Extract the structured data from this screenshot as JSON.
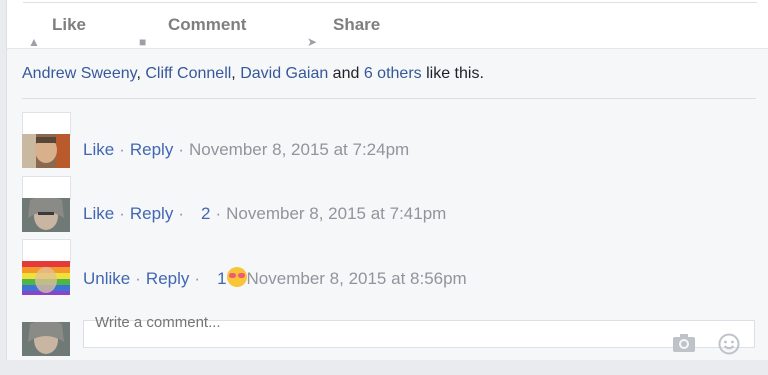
{
  "actions": {
    "like": "Like",
    "comment": "Comment",
    "share": "Share"
  },
  "likes": {
    "names": [
      "Andrew Sweeny",
      "Cliff Connell",
      "David Gaian"
    ],
    "sep1": ", ",
    "sep2": ", ",
    "conj": " and ",
    "others": "6 others",
    "suffix": " like this."
  },
  "comments": [
    {
      "like_label": "Like",
      "reply_label": "Reply",
      "timestamp": "November 8, 2015 at 7:24pm",
      "reaction_count": ""
    },
    {
      "like_label": "Like",
      "reply_label": "Reply",
      "timestamp": "November 8, 2015 at 7:41pm",
      "reaction_count": "2"
    },
    {
      "like_label": "Unlike",
      "reply_label": "Reply",
      "timestamp": "November 8, 2015 at 8:56pm",
      "reaction_count": "1"
    }
  ],
  "separator": "·",
  "write_comment": {
    "placeholder": "Write a comment..."
  },
  "colors": {
    "link": "#4267b2",
    "names": "#365899",
    "meta": "#90949c",
    "background": "#f6f7f9"
  },
  "icons": [
    "thumbs-up-icon",
    "comment-icon",
    "share-arrow-icon",
    "camera-icon",
    "emoji-icon",
    "heart-eyes-emoji-icon"
  ]
}
